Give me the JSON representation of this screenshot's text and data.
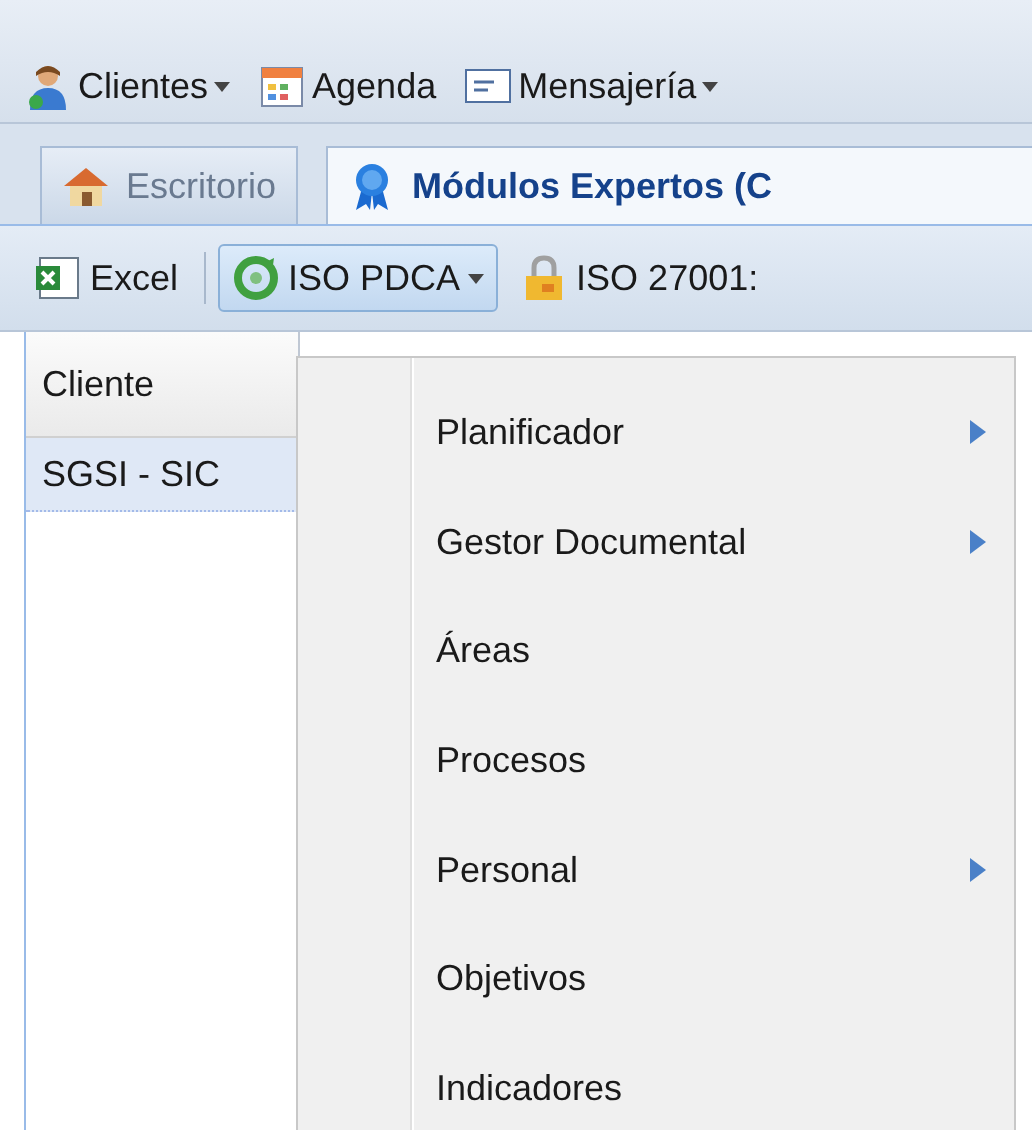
{
  "top_menu": [
    {
      "label": "Clientes",
      "kind": "person",
      "dropdown": true
    },
    {
      "label": "Agenda",
      "kind": "calendar",
      "dropdown": false
    },
    {
      "label": "Mensajería",
      "kind": "message",
      "dropdown": true
    }
  ],
  "tabs": [
    {
      "label": "Escritorio",
      "kind": "home",
      "selected": false
    },
    {
      "label": "Módulos Expertos (C",
      "kind": "ribbon",
      "selected": true
    }
  ],
  "toolbar": [
    {
      "label": "Excel",
      "kind": "sheet",
      "dropdown": false,
      "pressed": false
    },
    {
      "label": "ISO PDCA",
      "kind": "cycle",
      "dropdown": true,
      "pressed": true
    },
    {
      "label": "ISO 27001:",
      "kind": "lock",
      "dropdown": false,
      "pressed": false
    }
  ],
  "grid": {
    "columns": [
      "Cliente"
    ],
    "rows": [
      {
        "cells": [
          "SGSI - SIC"
        ],
        "selected": true
      }
    ]
  },
  "menu": {
    "items": [
      {
        "label": "Planificador",
        "submenu": true
      },
      {
        "label": "Gestor Documental",
        "submenu": true
      },
      {
        "label": "Áreas",
        "submenu": false
      },
      {
        "label": "Procesos",
        "submenu": false
      },
      {
        "label": "Personal",
        "submenu": true
      },
      {
        "label": "Objetivos",
        "submenu": false
      },
      {
        "label": "Indicadores",
        "submenu": false
      }
    ]
  }
}
